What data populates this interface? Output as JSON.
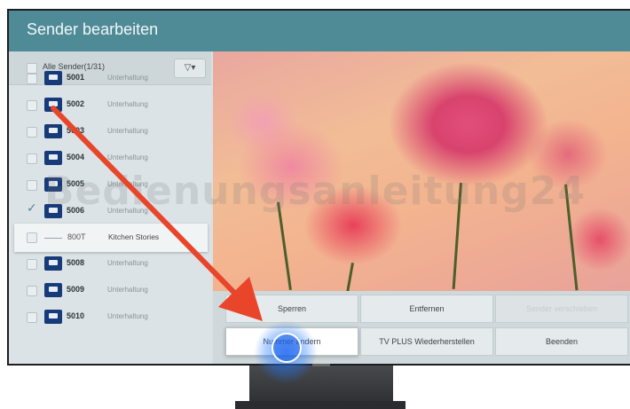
{
  "header": {
    "title": "Sender bearbeiten"
  },
  "list": {
    "header_label": "Alle Sender(1/31)",
    "filter_icon": "filter-icon"
  },
  "channels": [
    {
      "number": "5001",
      "name": "Unterhaltung",
      "type": "channel",
      "checked": false
    },
    {
      "number": "5002",
      "name": "Unterhaltung",
      "type": "channel",
      "checked": false
    },
    {
      "number": "5003",
      "name": "Unterhaltung",
      "type": "channel",
      "checked": false
    },
    {
      "number": "5004",
      "name": "Unterhaltung",
      "type": "channel",
      "checked": false
    },
    {
      "number": "5005",
      "name": "Unterhaltung",
      "type": "channel",
      "checked": false
    },
    {
      "number": "5006",
      "name": "Unterhaltung",
      "type": "channel",
      "checked": true
    },
    {
      "number": "800T",
      "name": "Kitchen Stories",
      "type": "selected",
      "checked": false
    },
    {
      "number": "5008",
      "name": "Unterhaltung",
      "type": "channel",
      "checked": false
    },
    {
      "number": "5009",
      "name": "Unterhaltung",
      "type": "channel",
      "checked": false
    },
    {
      "number": "5010",
      "name": "Unterhaltung",
      "type": "channel",
      "checked": false
    }
  ],
  "actions": {
    "lock": "Sperren",
    "remove": "Entfernen",
    "disabled_action": "Sender verschieben",
    "change_number": "Nummer ändern",
    "tv_plus_restore": "TV PLUS Wiederherstellen",
    "quit": "Beenden"
  },
  "watermark": "Bedienungsanleitung24",
  "colors": {
    "header": "#4f8b97",
    "arrow": "#e8452a",
    "tap_indicator": "#1e78ff",
    "channel_icon": "#173a79"
  }
}
